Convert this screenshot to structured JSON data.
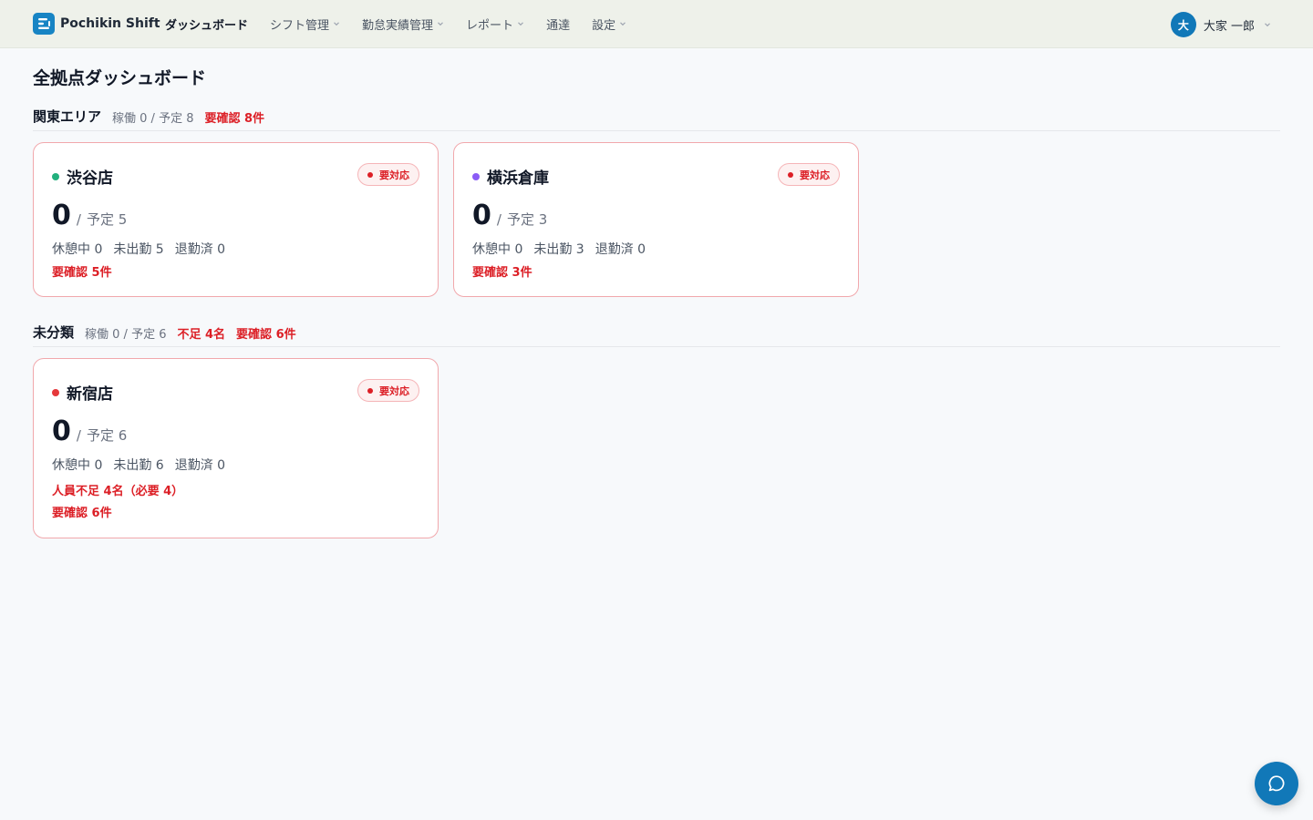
{
  "header": {
    "brand": "Pochikin Shift",
    "nav": [
      {
        "label": "ダッシュボード",
        "active": true,
        "dropdown": false
      },
      {
        "label": "シフト管理",
        "active": false,
        "dropdown": true
      },
      {
        "label": "勤怠実績管理",
        "active": false,
        "dropdown": true
      },
      {
        "label": "レポート",
        "active": false,
        "dropdown": true
      },
      {
        "label": "通達",
        "active": false,
        "dropdown": false
      },
      {
        "label": "設定",
        "active": false,
        "dropdown": true
      }
    ],
    "user": {
      "avatar_initial": "大",
      "name": "大家 一郎"
    }
  },
  "page": {
    "title": "全拠点ダッシュボード"
  },
  "groups": [
    {
      "name": "関東エリア",
      "stats": "稼働 0 / 予定 8",
      "alerts": [
        "要確認 8件"
      ],
      "stores": [
        {
          "name": "渋谷店",
          "dot_color": "#22b07d",
          "badge": "要対応",
          "working": "0",
          "sep": "/",
          "planned": "予定 5",
          "statuses": [
            "休憩中 0",
            "未出勤 5",
            "退勤済 0"
          ],
          "alerts": [
            "要確認 5件"
          ]
        },
        {
          "name": "横浜倉庫",
          "dot_color": "#8b5cf6",
          "badge": "要対応",
          "working": "0",
          "sep": "/",
          "planned": "予定 3",
          "statuses": [
            "休憩中 0",
            "未出勤 3",
            "退勤済 0"
          ],
          "alerts": [
            "要確認 3件"
          ]
        }
      ]
    },
    {
      "name": "未分類",
      "stats": "稼働 0 / 予定 6",
      "alerts": [
        "不足 4名",
        "要確認 6件"
      ],
      "stores": [
        {
          "name": "新宿店",
          "dot_color": "#e5383b",
          "badge": "要対応",
          "working": "0",
          "sep": "/",
          "planned": "予定 6",
          "statuses": [
            "休憩中 0",
            "未出勤 6",
            "退勤済 0"
          ],
          "alerts": [
            "人員不足 4名（必要 4）",
            "要確認 6件"
          ]
        }
      ]
    }
  ],
  "chat": {
    "icon": "chat-bubble-icon"
  },
  "colors": {
    "accent": "#1178b8",
    "alert": "#dc1f26",
    "header_bg": "#eef1ea"
  }
}
